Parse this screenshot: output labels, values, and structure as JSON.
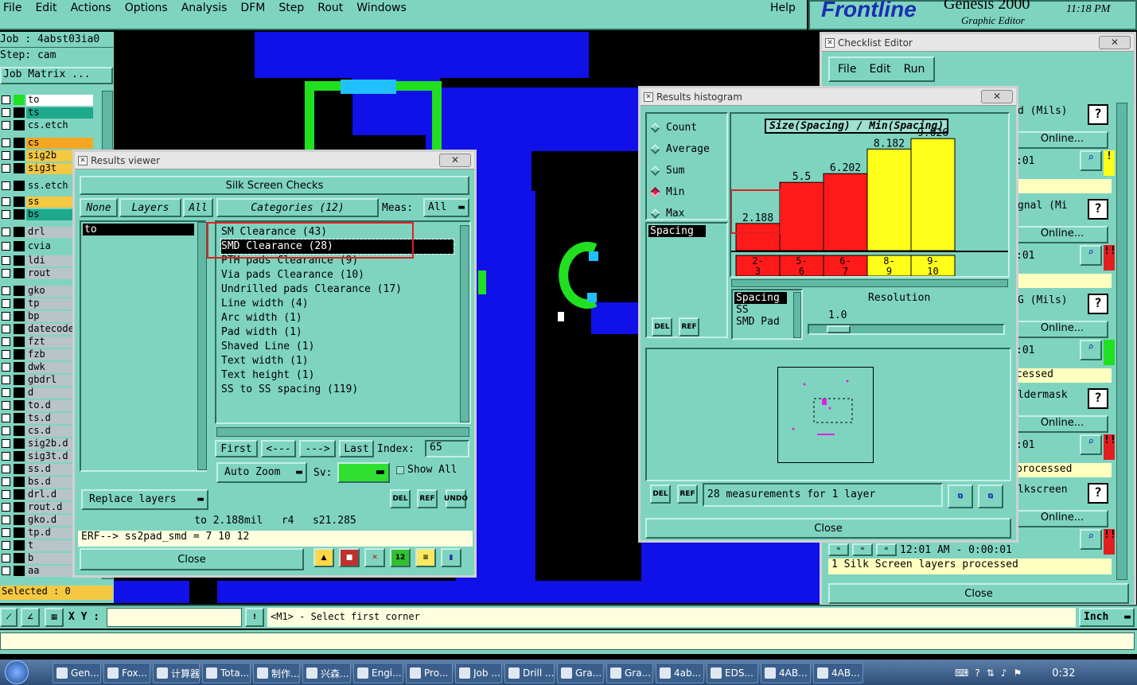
{
  "menu": {
    "items": [
      "File",
      "Edit",
      "Actions",
      "Options",
      "Analysis",
      "DFM",
      "Step",
      "Rout",
      "Windows"
    ],
    "help": "Help"
  },
  "brand": {
    "logo": "Frontline",
    "product": "Genesis 2000",
    "sub": "Graphic Editor",
    "time": "11:18 PM"
  },
  "job": {
    "job": "Job : 4abst03ia0",
    "step": "Step: cam",
    "matrix": "Job Matrix ...",
    "selected": "Selected : 0"
  },
  "layers": [
    {
      "name": "to",
      "color": "#ffffff"
    },
    {
      "name": "ts",
      "color": "#1ea88c"
    },
    {
      "name": "cs.etch",
      "color": "#7fd4c0"
    },
    {
      "name": "cs",
      "color": "#f5a623"
    },
    {
      "name": "sig2b",
      "color": "#f5c842"
    },
    {
      "name": "sig3t",
      "color": "#f5c842"
    },
    {
      "name": "ss.etch",
      "color": "#7fd4c0"
    },
    {
      "name": "ss",
      "color": "#f5c842"
    },
    {
      "name": "bs",
      "color": "#1ea88c"
    },
    {
      "name": "drl",
      "color": "#b8c4c8"
    },
    {
      "name": "cvia",
      "color": "#7fd4c0"
    },
    {
      "name": "ldi",
      "color": "#b8c4c8"
    },
    {
      "name": "rout",
      "color": "#b8c4c8"
    },
    {
      "name": "gko",
      "color": "#b8c4c8"
    },
    {
      "name": "tp",
      "color": "#b8c4c8"
    },
    {
      "name": "bp",
      "color": "#b8c4c8"
    },
    {
      "name": "datecode",
      "color": "#b8c4c8"
    },
    {
      "name": "fzt",
      "color": "#b8c4c8"
    },
    {
      "name": "fzb",
      "color": "#b8c4c8"
    },
    {
      "name": "dwk",
      "color": "#b8c4c8"
    },
    {
      "name": "gbdrl",
      "color": "#b8c4c8"
    },
    {
      "name": "d",
      "color": "#b8c4c8"
    },
    {
      "name": "to.d",
      "color": "#b8c4c8"
    },
    {
      "name": "ts.d",
      "color": "#b8c4c8"
    },
    {
      "name": "cs.d",
      "color": "#b8c4c8"
    },
    {
      "name": "sig2b.d",
      "color": "#b8c4c8"
    },
    {
      "name": "sig3t.d",
      "color": "#b8c4c8"
    },
    {
      "name": "ss.d",
      "color": "#b8c4c8"
    },
    {
      "name": "bs.d",
      "color": "#b8c4c8"
    },
    {
      "name": "drl.d",
      "color": "#b8c4c8"
    },
    {
      "name": "rout.d",
      "color": "#b8c4c8"
    },
    {
      "name": "gko.d",
      "color": "#b8c4c8"
    },
    {
      "name": "tp.d",
      "color": "#b8c4c8"
    },
    {
      "name": "t",
      "color": "#b8c4c8"
    },
    {
      "name": "b",
      "color": "#b8c4c8"
    },
    {
      "name": "aa",
      "color": "#b8c4c8"
    }
  ],
  "results_viewer": {
    "title": "Results viewer",
    "header": "Silk Screen Checks",
    "none": "None",
    "layers": "Layers",
    "all": "All",
    "categories_label": "Categories (12)",
    "meas_label": "Meas:",
    "meas_value": "All",
    "layer_item": "to",
    "categories": [
      "SM Clearance (43)",
      "SMD Clearance (28)",
      "PTH pads Clearance (9)",
      "Via pads Clearance (10)",
      "Undrilled pads Clearance (17)",
      "Line width (4)",
      "Arc width (1)",
      "Pad width (1)",
      "Shaved Line (1)",
      "Text width (1)",
      "Text height (1)",
      "SS to SS spacing (119)"
    ],
    "first": "First",
    "prev": "<---",
    "next": "--->",
    "last": "Last",
    "index_label": "Index:",
    "index_value": "65",
    "auto_zoom": "Auto Zoom",
    "sv": "Sv:",
    "show_all": "Show All",
    "replace_layers": "Replace layers",
    "del": "DEL",
    "ref": "REF",
    "undo": "UNDO",
    "measure_line": "to 2.188mil   r4   s21.285",
    "erf_line": "ERF--> ss2pad_smd = 7 10 12",
    "close": "Close"
  },
  "histogram": {
    "title": "Results histogram",
    "options": [
      "Count",
      "Average",
      "Sum",
      "Min",
      "Max"
    ],
    "selected_option": "Min",
    "list_label": "Spacing",
    "chart_title": "Size(Spacing) / Min(Spacing)",
    "list2": [
      "Spacing",
      "SS",
      "SMD Pad"
    ],
    "resolution_label": "Resolution",
    "resolution_value": "1.0",
    "status": "28 measurements for 1 layer",
    "close": "Close",
    "del": "DEL",
    "ref": "REF"
  },
  "chart_data": {
    "type": "bar",
    "title": "Size(Spacing) / Min(Spacing)",
    "categories": [
      "2-3",
      "5-6",
      "6-7",
      "8-9",
      "9-10"
    ],
    "values": [
      2.188,
      5.5,
      6.202,
      8.182,
      9.026
    ],
    "labels": [
      "2.188",
      "5.5",
      "6.202",
      "8.182",
      "9.026"
    ],
    "colors": [
      "#ff1a1a",
      "#ff1a1a",
      "#ff1a1a",
      "#ffff1a",
      "#ffff1a"
    ],
    "ylim": [
      0,
      10
    ],
    "grid": false,
    "legend": "none"
  },
  "checklist": {
    "title": "Checklist Editor",
    "menu": [
      "File",
      "Edit",
      "Run"
    ],
    "rows": [
      {
        "name": "d (Mils)",
        "online": "Online...",
        "time": ":01",
        "flag": "!",
        "flag_color": "#ffff1a"
      },
      {
        "name": "gnal (Mi",
        "online": "Online...",
        "time": ":01",
        "flag": "!!",
        "flag_color": "#e02020"
      },
      {
        "name": "G (Mils)",
        "online": "Online...",
        "time": ":01",
        "flag": "",
        "flag_color": "#20e020",
        "status": "cessed"
      },
      {
        "name": "ldermask",
        "online": "Online...",
        "time": ":01",
        "flag": "!!",
        "flag_color": "#e02020",
        "status": "processed"
      },
      {
        "name": "lkscreen",
        "online": "Online...",
        "time": "12:01 AM - 0:00:01",
        "flag": "!!",
        "flag_color": "#e02020",
        "status": "1 Silk Screen layers processed"
      }
    ],
    "close": "Close"
  },
  "bottom": {
    "xy": "X Y :",
    "prompt": "<M1> - Select first corner",
    "unit": "Inch"
  },
  "taskbar": {
    "items": [
      "Gen...",
      "Fox...",
      "计算器",
      "Tota...",
      "制作...",
      "兴森...",
      "Engi...",
      "Pro...",
      "Job ...",
      "Drill ...",
      "Gra...",
      "Gra...",
      "4ab...",
      "EDS...",
      "4AB...",
      "4AB..."
    ],
    "clock": "0:32"
  }
}
